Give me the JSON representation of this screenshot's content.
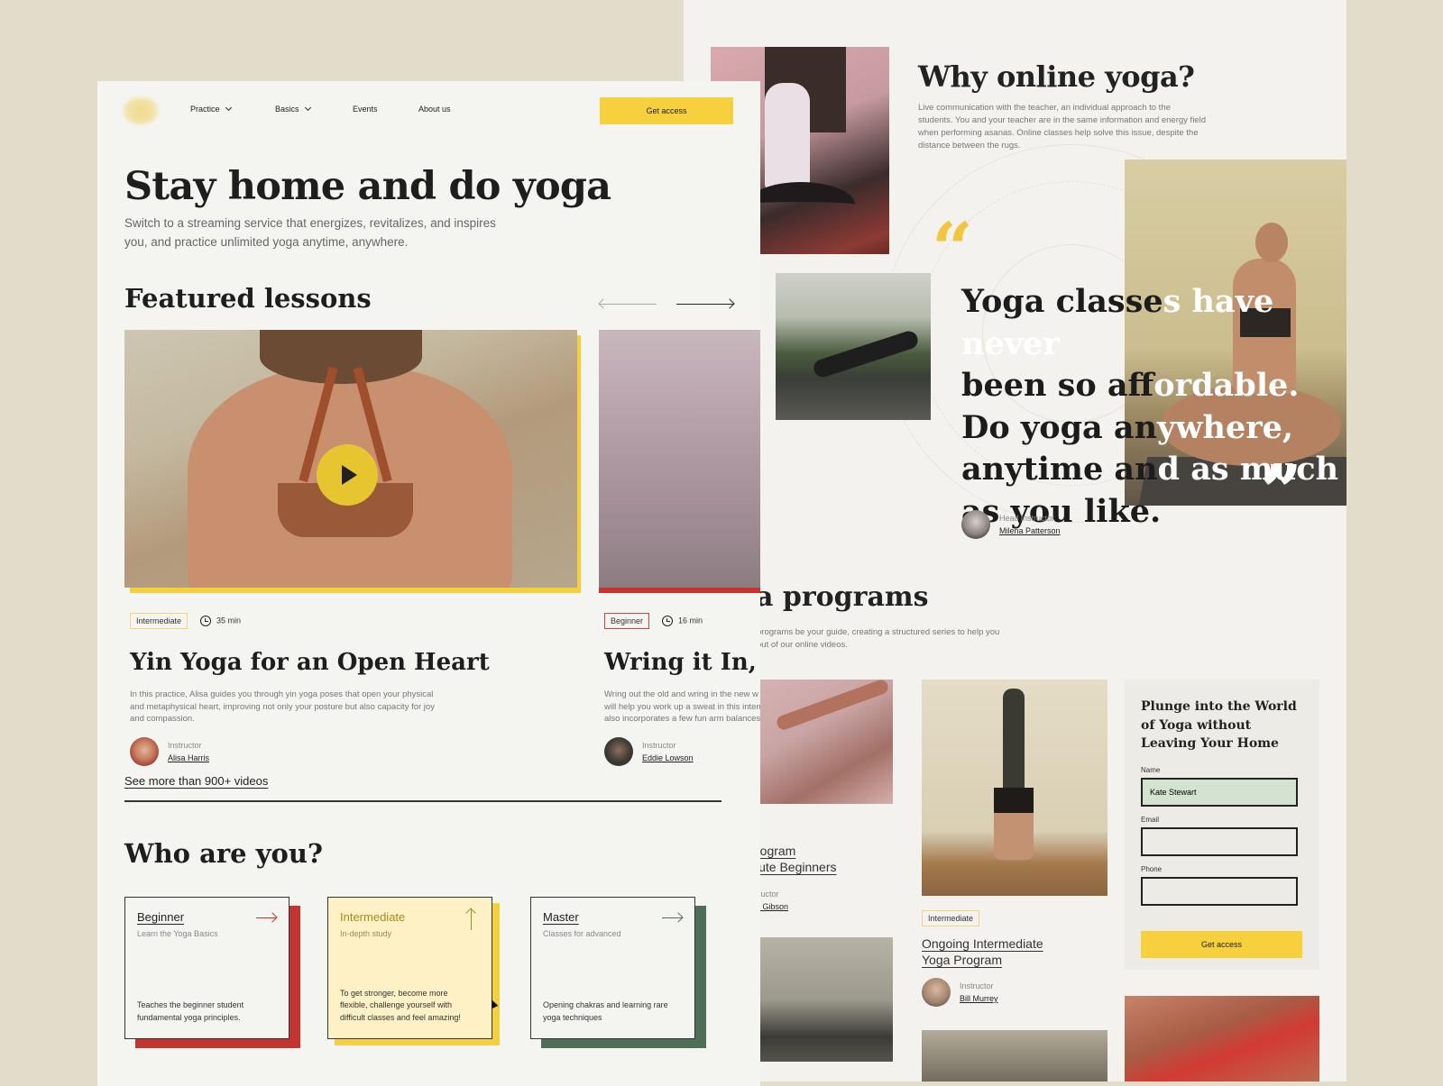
{
  "front": {
    "nav": {
      "items": [
        {
          "label": "Practice",
          "dropdown": true
        },
        {
          "label": "Basics",
          "dropdown": true
        },
        {
          "label": "Events",
          "dropdown": false
        },
        {
          "label": "About us",
          "dropdown": false
        }
      ],
      "cta": "Get access"
    },
    "hero": {
      "title": "Stay home and do yoga",
      "subtitle": "Switch to a streaming service that energizes, revitalizes, and inspires you, and practice unlimited yoga anytime, anywhere."
    },
    "featured": {
      "title": "Featured lessons",
      "lessons": [
        {
          "level": "Intermediate",
          "duration": "35 min",
          "title": "Yin Yoga for an Open Heart",
          "description": "In this practice, Alisa guides you through yin yoga poses that open your physical and metaphysical heart, improving not only your posture but also capacity for joy and compassion.",
          "instructor_label": "Instructor",
          "instructor": "Alisa Harris",
          "accent": "#f4cf3f"
        },
        {
          "level": "Beginner",
          "duration": "16 min",
          "title": "Wring it In, Wr",
          "description_lines": [
            "Wring out the old and wring in the new w",
            "will help you work up a sweat in this intern",
            "also incorporates a few fun arm balances."
          ],
          "instructor_label": "Instructor",
          "instructor": "Eddie Lowson",
          "accent": "#c3352e"
        }
      ],
      "see_more": "See more than 900+ videos"
    },
    "who": {
      "title": "Who are you?",
      "cards": [
        {
          "title": "Beginner",
          "subtitle": "Learn the Yoga Basics",
          "description": "Teaches the beginner student fundamental yoga principles.",
          "accent": "#c3352e"
        },
        {
          "title": "Intermediate",
          "subtitle": "In-depth study",
          "description": "To get stronger, become more flexible, challenge yourself with difficult classes and feel amazing!",
          "accent": "#f4cf3f"
        },
        {
          "title": "Master",
          "subtitle": "Classes for advanced",
          "description": "Opening chakras and learning rare yoga techniques",
          "accent": "#4f6e57"
        }
      ]
    }
  },
  "back": {
    "why": {
      "title": "Why online yoga?",
      "text": "Live communication with the teacher, an individual approach to the students. You and your teacher are in the same information and energy field when performing asanas. Online classes help solve this issue, despite the distance between the rugs."
    },
    "quote": {
      "open_mark": "“",
      "close_mark": "”",
      "lines": [
        {
          "dark": "Yoga classe",
          "light": "s have never"
        },
        {
          "dark": "been so aff",
          "light": "ordable."
        },
        {
          "dark": "Do yoga an",
          "light": "ywhere,"
        },
        {
          "dark": "anytime an",
          "light": "d as much"
        },
        {
          "dark": "as you like.",
          "light": ""
        }
      ],
      "author_label": "Head instructor",
      "author": "Milena Patterson"
    },
    "programs": {
      "title": "a programs",
      "text_lines": [
        "programs be your guide, creating a structured series to help you",
        "out of our online videos."
      ],
      "items": [
        {
          "name_lines": [
            "rogram ",
            "lute Beginners"
          ],
          "instructor_label": "tructor",
          "instructor": "n Gibson"
        },
        {
          "level": "Intermediate",
          "name_lines": [
            "Ongoing Intermediate",
            "Yoga Program"
          ],
          "instructor_label": "Instructor",
          "instructor": "Bill Murrey"
        }
      ]
    },
    "form": {
      "title": "Plunge into the World of Yoga without Leaving Your Home",
      "fields": [
        {
          "label": "Name",
          "value": "Kate Stewart",
          "placeholder": ""
        },
        {
          "label": "Email",
          "value": "",
          "placeholder": ""
        },
        {
          "label": "Phone",
          "value": "",
          "placeholder": ""
        }
      ],
      "submit": "Get access"
    }
  },
  "colors": {
    "yellow": "#f6d13d",
    "red": "#c3352e",
    "green": "#4f6e57",
    "page_bg": "#e2ddca",
    "paper": "#f4f4f1"
  }
}
